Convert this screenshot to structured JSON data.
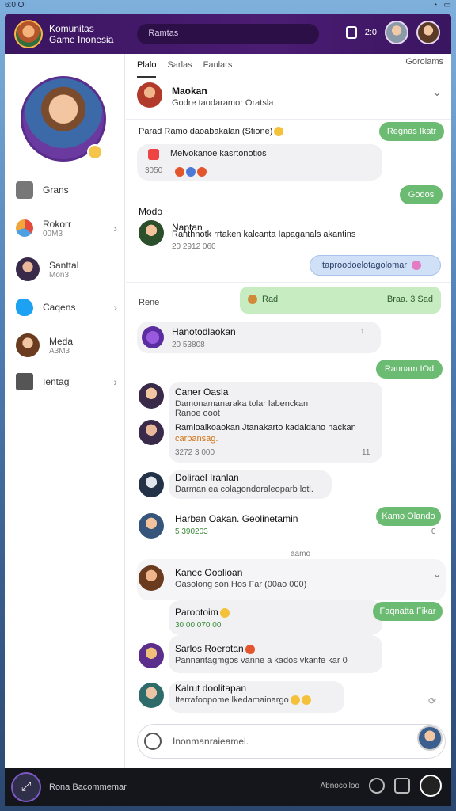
{
  "system": {
    "time": "6:0 Ol"
  },
  "header": {
    "app_name_line1": "Komunitas",
    "app_name_line2": "Game Inonesia",
    "search_value": "Ramtas",
    "counter": "2:0"
  },
  "sidebar": {
    "items": [
      {
        "label": "Grans",
        "sub": ""
      },
      {
        "label": "Rokorr",
        "sub": "00M3"
      },
      {
        "label": "Santtal",
        "sub": "Mon3"
      },
      {
        "label": "Caqens",
        "sub": ""
      },
      {
        "label": "Meda",
        "sub": "A3M3"
      },
      {
        "label": "Ientag",
        "sub": ""
      }
    ]
  },
  "tabs": {
    "items": [
      "Plalo",
      "Sarlas",
      "Fanlars"
    ],
    "right": "Gorolams"
  },
  "pinned": {
    "name": "Maokan",
    "preview": "Godre taodaramor Oratsla"
  },
  "messages": {
    "m1": "Parad Ramo daoabakalan  (Stione)",
    "m1_reply": "Regnas Ikatr",
    "m2_text": "Melvokanoe kasrtonotios",
    "m2_meta": "3050",
    "m2_reply": "Godos",
    "section": "Modo",
    "m3_name": "Naptan",
    "m3_text": "Ranthnotk rrtaken kalcanta Iapaganals akantins",
    "m3_meta": "20 2912 060",
    "m3_reply": "Itaproodoelotagolomar",
    "m4_label": "Rene",
    "m4_bubble": "Rad",
    "m4_meta": "Braa. 3 Sad",
    "m5_name": "Hanotodlaokan",
    "m5_meta": "20 53808",
    "m5_reply": "Rannam IOd",
    "m6_name": "Caner Oasla",
    "m6_text": "Damonamanaraka tolar labenckan",
    "m6_text2": "Ranoe ooot",
    "m6_text3": "Ramloalkoaokan.Jtanakarto kadaldano nackan",
    "m6_text4": "carpansag.",
    "m6_meta": "3272 3 000",
    "m6_meta2": "11",
    "m7_name": "Dolirael Iranlan",
    "m7_text": "Darman ea colagondoraleoparb lotl.",
    "m8_name": "Harban Oakan. Geolinetamin",
    "m8_meta": "5 390203",
    "m8_reply": "Kamo Olando",
    "m8_flag": "0",
    "sep": "aamo",
    "m9_name": "Kanec Ooolioan",
    "m9_text": "Oasolong son Hos Far (00ao 000)",
    "m10_name": "Parootoim",
    "m10_meta": "30 00 070 00",
    "m10_reply": "Faqnatta Fikar",
    "m11_name": "Sarlos Roerotan",
    "m11_text": "Pannaritagmgos vanne a kados vkanfe kar 0",
    "m12_name": "Kalrut doolitapan",
    "m12_text": "Iterrafoopome lkedamainargo"
  },
  "composer": {
    "placeholder": "Inonmanraieamel."
  },
  "bottombar": {
    "label": "Rona Bacommemar",
    "right_label": "Abnocolloo"
  }
}
